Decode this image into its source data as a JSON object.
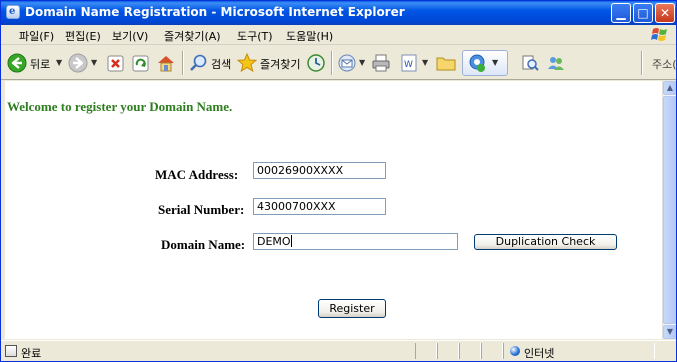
{
  "window": {
    "title": "Domain Name Registration - Microsoft Internet Explorer",
    "app_icon_glyph": "e",
    "controls": {
      "minimize": "▁",
      "maximize": "□",
      "close": "✕"
    }
  },
  "menu": [
    {
      "label": "파일(F)"
    },
    {
      "label": "편집(E)"
    },
    {
      "label": "보기(V)"
    },
    {
      "label": "즐겨찾기(A)"
    },
    {
      "label": "도구(T)"
    },
    {
      "label": "도움말(H)"
    }
  ],
  "toolbar": {
    "back_label": "뒤로",
    "search_label": "검색",
    "favorites_label": "즐겨찾기",
    "address_label": "주소(D)",
    "dropdown_glyph": "▼"
  },
  "page": {
    "welcome": "Welcome to register your Domain Name.",
    "mac_label": "MAC Address:",
    "mac_value": "00026900XXXX",
    "serial_label": "Serial Number:",
    "serial_value": "43000700XXX",
    "domain_label": "Domain Name:",
    "domain_value": "DEMO",
    "duplication_button": "Duplication Check",
    "register_button": "Register"
  },
  "scrollbar": {
    "up_glyph": "▲",
    "down_glyph": "▼"
  },
  "status": {
    "text": "완료",
    "zone": "인터넷"
  },
  "colors": {
    "titlebar": "#0055e5",
    "welcome_text": "#2e7d1f",
    "window_bg": "#ece9d8",
    "input_border": "#7f9db9"
  }
}
